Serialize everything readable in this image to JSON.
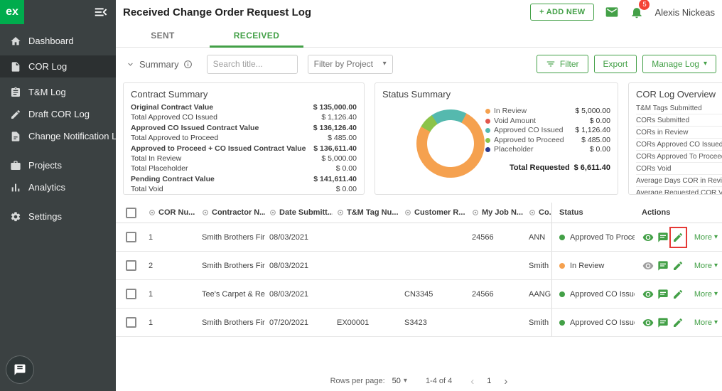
{
  "sidebar": {
    "logo_text": "ex",
    "items": [
      {
        "label": "Dashboard"
      },
      {
        "label": "COR Log"
      },
      {
        "label": "T&M Log"
      },
      {
        "label": "Draft COR Log"
      },
      {
        "label": "Change Notification Log"
      },
      {
        "label": "Projects"
      },
      {
        "label": "Analytics"
      },
      {
        "label": "Settings"
      }
    ]
  },
  "topbar": {
    "title": "Received Change Order Request Log",
    "add_new_label": "+ ADD NEW",
    "notification_count": "5",
    "user_name": "Alexis Nickeas"
  },
  "tabs": {
    "sent": "SENT",
    "received": "RECEIVED"
  },
  "toolbar": {
    "summary_label": "Summary",
    "search_placeholder": "Search title...",
    "project_filter_label": "Filter by Project",
    "filter_label": "Filter",
    "export_label": "Export",
    "manage_log_label": "Manage Log"
  },
  "contract_summary": {
    "title": "Contract Summary",
    "rows": [
      {
        "label": "Original Contract Value",
        "value": "$ 135,000.00",
        "bold": true
      },
      {
        "label": "Total Approved CO Issued",
        "value": "$ 1,126.40",
        "bold": false
      },
      {
        "label": "Approved CO Issued Contract Value",
        "value": "$ 136,126.40",
        "bold": true
      },
      {
        "label": "Total Approved to Proceed",
        "value": "$ 485.00",
        "bold": false
      },
      {
        "label": "Approved to Proceed + CO Issued Contract Value",
        "value": "$ 136,611.40",
        "bold": true
      },
      {
        "label": "Total In Review",
        "value": "$ 5,000.00",
        "bold": false
      },
      {
        "label": "Total Placeholder",
        "value": "$ 0.00",
        "bold": false
      },
      {
        "label": "Pending Contract Value",
        "value": "$ 141,611.40",
        "bold": true
      },
      {
        "label": "Total Void",
        "value": "$ 0.00",
        "bold": false
      }
    ]
  },
  "status_summary": {
    "title": "Status Summary"
  },
  "chart_data": {
    "type": "pie",
    "donut": true,
    "title": "Status Summary",
    "labels": [
      "In Review",
      "Void Amount",
      "Approved CO Issued",
      "Approved to Proceed",
      "Placeholder"
    ],
    "values": [
      5000.0,
      0.0,
      1126.4,
      485.0,
      0.0
    ],
    "display_values": [
      "$ 5,000.00",
      "$ 0.00",
      "$ 1,126.40",
      "$ 485.00",
      "$ 0.00"
    ],
    "colors": [
      "#F5A14F",
      "#E2574C",
      "#55B9AE",
      "#8BC34A",
      "#2D3A8C"
    ],
    "total_label": "Total Requested",
    "total_value": "$ 6,611.40",
    "legend_position": "right"
  },
  "cor_overview": {
    "title": "COR Log Overview",
    "items": [
      "T&M Tags Submitted",
      "CORs Submitted",
      "CORs in Review",
      "CORs Approved CO Issued",
      "CORs Approved To Proceed",
      "CORs Void",
      "Average Days COR in Review",
      "Average Requested COR Value"
    ]
  },
  "table": {
    "headers": [
      "COR Nu...",
      "Contractor N...",
      "Date Submitt...",
      "T&M Tag Nu...",
      "Customer R...",
      "My Job N...",
      "Co...",
      "Status",
      "Actions"
    ],
    "rows": [
      {
        "cor_number": "1",
        "contractor": "Smith Brothers Fire ...",
        "date_submitted": "08/03/2021",
        "tm_tag_number": "",
        "customer_ref": "",
        "my_job_number": "24566",
        "co": "ANN",
        "status": "Approved To Proceed",
        "status_color": "#43A047",
        "view_color": "#43A047",
        "more_label": "More"
      },
      {
        "cor_number": "2",
        "contractor": "Smith Brothers Fire ...",
        "date_submitted": "08/03/2021",
        "tm_tag_number": "",
        "customer_ref": "",
        "my_job_number": "",
        "co": "Smith",
        "status": "In Review",
        "status_color": "#F5A14F",
        "view_color": "#9E9E9E",
        "more_label": "More"
      },
      {
        "cor_number": "1",
        "contractor": "Tee's Carpet & Resil...",
        "date_submitted": "08/03/2021",
        "tm_tag_number": "",
        "customer_ref": "CN3345",
        "my_job_number": "24566",
        "co": "AANG",
        "status": "Approved CO Issued",
        "status_color": "#43A047",
        "view_color": "#43A047",
        "more_label": "More"
      },
      {
        "cor_number": "1",
        "contractor": "Smith Brothers Fire ...",
        "date_submitted": "07/20/2021",
        "tm_tag_number": "EX00001",
        "customer_ref": "S3423",
        "my_job_number": "",
        "co": "Smith",
        "status": "Approved CO Issued",
        "status_color": "#43A047",
        "view_color": "#43A047",
        "more_label": "More"
      }
    ]
  },
  "footer": {
    "rows_per_page_label": "Rows per page:",
    "rows_per_page_value": "50",
    "range_label": "1-4 of 4",
    "page_number": "1"
  },
  "colors": {
    "accent_green": "#43A047",
    "logo_green": "#00AC4D",
    "badge_red": "#F44336"
  }
}
